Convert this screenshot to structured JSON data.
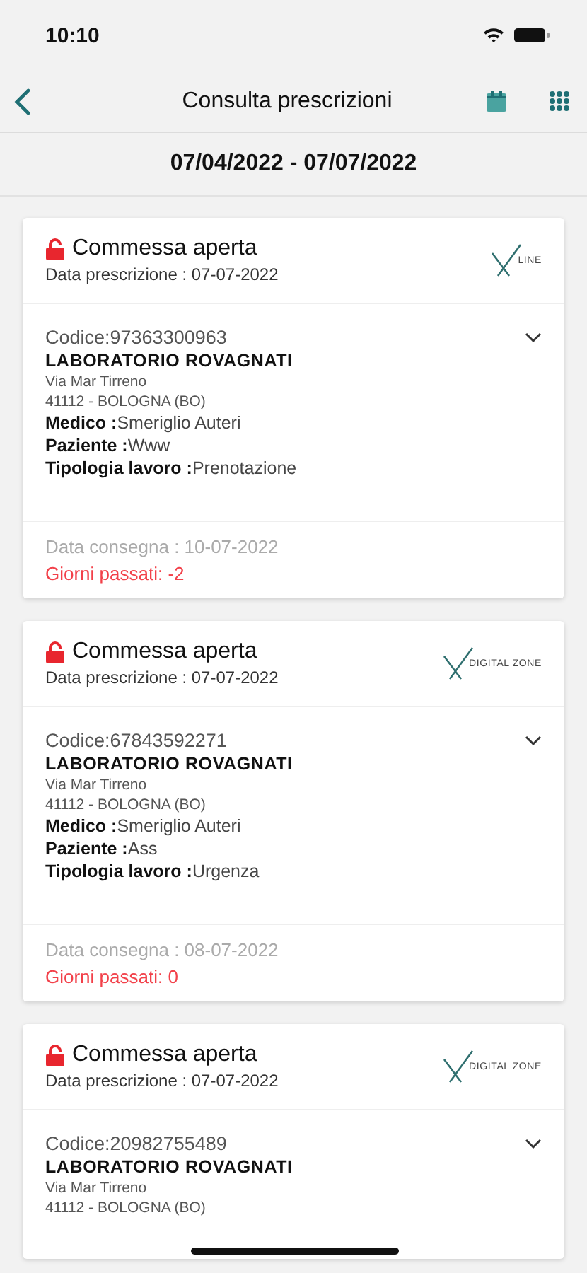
{
  "status_bar": {
    "time": "10:10"
  },
  "nav": {
    "title": "Consulta prescrizioni"
  },
  "date_range": "07/04/2022 - 07/07/2022",
  "cards": [
    {
      "status": "Commessa aperta",
      "locked": false,
      "date": "Data prescrizione : 07-07-2022",
      "logo_text": "LINE",
      "code": "Codice:97363300963",
      "lab": "LABORATORIO ROVAGNATI",
      "address": [
        "Via Mar Tirreno",
        "41112 - BOLOGNA (BO)"
      ],
      "fields": [
        {
          "label": "Medico :",
          "value": "Smeriglio Auteri"
        },
        {
          "label": "Paziente :",
          "value": "Www"
        },
        {
          "label": "Tipologia lavoro :",
          "value": "Prenotazione"
        }
      ],
      "delivery": "Data consegna : 10-07-2022",
      "days": "Giorni passati: -2"
    },
    {
      "status": "Commessa aperta",
      "locked": false,
      "date": "Data prescrizione : 07-07-2022",
      "logo_text": "DIGITAL ZONE",
      "code": "Codice:67843592271",
      "lab": "LABORATORIO ROVAGNATI",
      "address": [
        "Via Mar Tirreno",
        "41112 - BOLOGNA (BO)"
      ],
      "fields": [
        {
          "label": "Medico :",
          "value": "Smeriglio Auteri"
        },
        {
          "label": "Paziente :",
          "value": "Ass"
        },
        {
          "label": "Tipologia lavoro :",
          "value": "Urgenza"
        }
      ],
      "delivery": "Data consegna : 08-07-2022",
      "days": "Giorni passati: 0"
    },
    {
      "status": "Commessa aperta",
      "locked": false,
      "date": "Data prescrizione : 07-07-2022",
      "logo_text": "DIGITAL ZONE",
      "code": "Codice:20982755489",
      "lab": "LABORATORIO ROVAGNATI",
      "address": [
        "Via Mar Tirreno",
        "41112 - BOLOGNA (BO)"
      ]
    }
  ]
}
